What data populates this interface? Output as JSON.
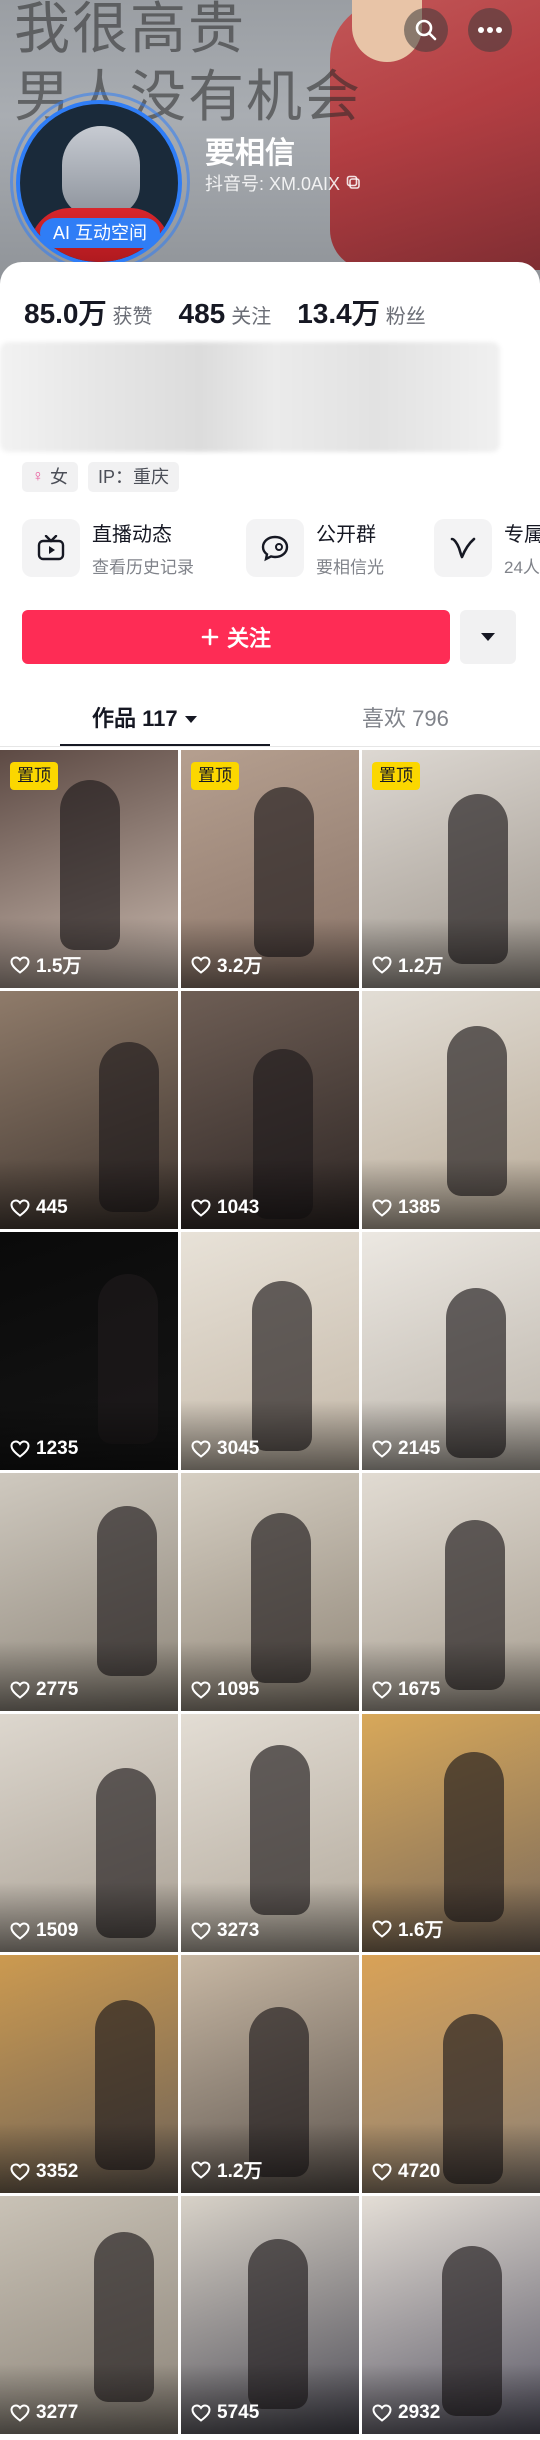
{
  "cover": {
    "overlay_line1": "我很高贵",
    "overlay_line2": "男人没有机会"
  },
  "profile": {
    "nickname": "要相信",
    "douyin_id": "抖音号: XM.0AIX",
    "ai_badge": "AI 互动空间"
  },
  "stats": [
    {
      "value": "85.0万",
      "label": "获赞"
    },
    {
      "value": "485",
      "label": "关注"
    },
    {
      "value": "13.4万",
      "label": "粉丝"
    }
  ],
  "tags": {
    "gender": "女",
    "ip": "IP：重庆"
  },
  "features": [
    {
      "title": "直播动态",
      "subtitle": "查看历史记录",
      "icon": "tv-icon"
    },
    {
      "title": "公开群",
      "subtitle": "要相信光",
      "icon": "chat-bubble-icon"
    },
    {
      "title": "专属",
      "subtitle": "24人",
      "icon": "v-badge-icon"
    }
  ],
  "actions": {
    "follow_label": "关注",
    "follow_color": "#fe2c55"
  },
  "tabs": {
    "works_label": "作品 117",
    "likes_label": "喜欢 796"
  },
  "pin_label": "置顶",
  "videos": [
    {
      "likes": "1.5万",
      "pinned": true,
      "bg": [
        "#5d4a44",
        "#c9b9ae"
      ]
    },
    {
      "likes": "3.2万",
      "pinned": true,
      "bg": [
        "#b59f8f",
        "#8a7468"
      ]
    },
    {
      "likes": "1.2万",
      "pinned": true,
      "bg": [
        "#ddd8d2",
        "#9d958c"
      ]
    },
    {
      "likes": "445",
      "pinned": false,
      "bg": [
        "#8f7b6a",
        "#3f352f"
      ]
    },
    {
      "likes": "1043",
      "pinned": false,
      "bg": [
        "#6e5e55",
        "#2e2624"
      ]
    },
    {
      "likes": "1385",
      "pinned": false,
      "bg": [
        "#e2ddd5",
        "#b8aa97"
      ]
    },
    {
      "likes": "1235",
      "pinned": false,
      "bg": [
        "#0a0a0a",
        "#151515"
      ]
    },
    {
      "likes": "3045",
      "pinned": false,
      "bg": [
        "#e8e2d8",
        "#c3b7a7"
      ]
    },
    {
      "likes": "2145",
      "pinned": false,
      "bg": [
        "#ece8e2",
        "#b9b2a8"
      ]
    },
    {
      "likes": "2775",
      "pinned": false,
      "bg": [
        "#cfc9bf",
        "#8c8478"
      ]
    },
    {
      "likes": "1095",
      "pinned": false,
      "bg": [
        "#d6cfc3",
        "#8f8577"
      ]
    },
    {
      "likes": "1675",
      "pinned": false,
      "bg": [
        "#e1dbd2",
        "#a69d90"
      ]
    },
    {
      "likes": "1509",
      "pinned": false,
      "bg": [
        "#ddd7ce",
        "#a89f93"
      ]
    },
    {
      "likes": "3273",
      "pinned": false,
      "bg": [
        "#e3ddd4",
        "#b1a89b"
      ]
    },
    {
      "likes": "1.6万",
      "pinned": false,
      "bg": [
        "#d8a85a",
        "#7a6a5c"
      ]
    },
    {
      "likes": "3352",
      "pinned": false,
      "bg": [
        "#cc9a50",
        "#6d6258"
      ]
    },
    {
      "likes": "1.2万",
      "pinned": false,
      "bg": [
        "#c8b8a4",
        "#5c544e"
      ]
    },
    {
      "likes": "4720",
      "pinned": false,
      "bg": [
        "#d9a257",
        "#8d8175"
      ]
    },
    {
      "likes": "3277",
      "pinned": false,
      "bg": [
        "#c9c2b6",
        "#8b8378"
      ]
    },
    {
      "likes": "5745",
      "pinned": false,
      "bg": [
        "#d8d2c8",
        "#4d4c56"
      ]
    },
    {
      "likes": "2932",
      "pinned": false,
      "bg": [
        "#e4ded6",
        "#5a5866"
      ]
    }
  ]
}
